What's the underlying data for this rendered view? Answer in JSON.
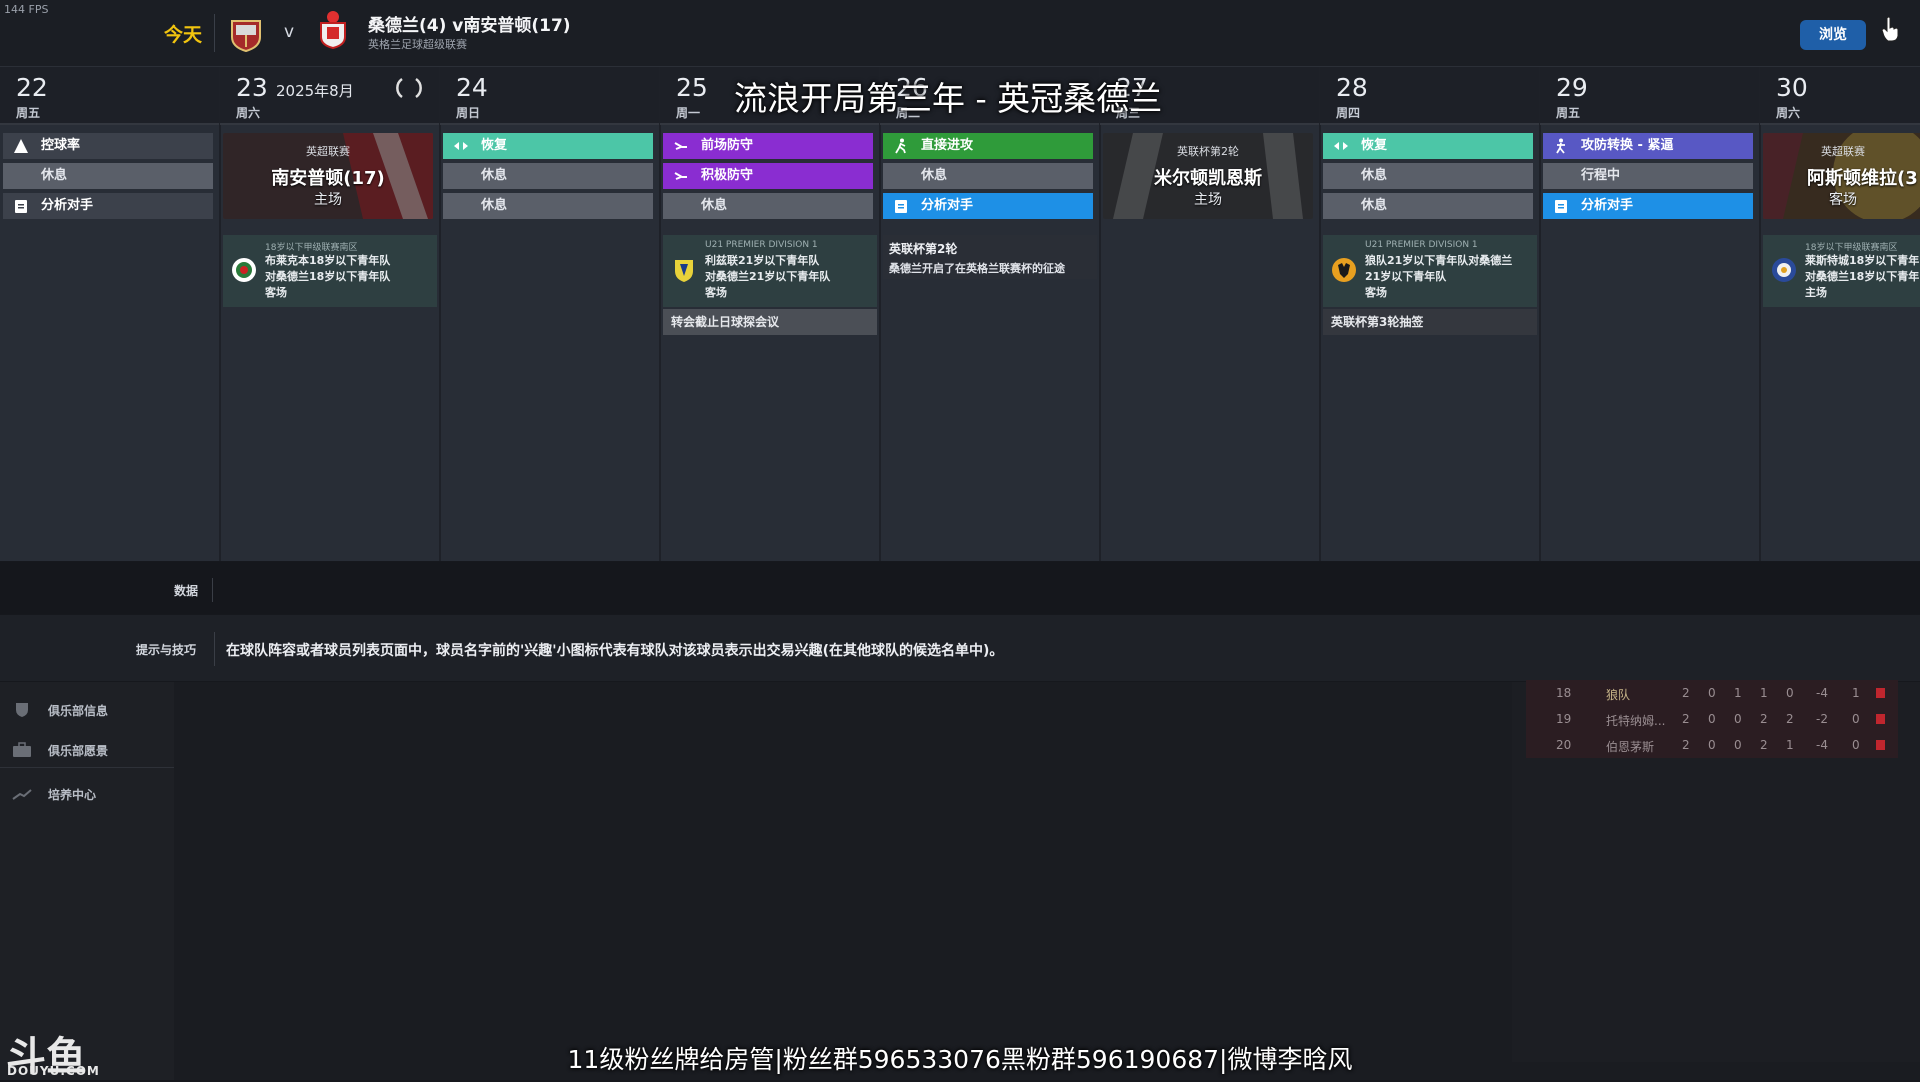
{
  "fps": "144 FPS",
  "header": {
    "today": "今天",
    "vs": "v",
    "match_title": "桑德兰(4) v南安普顿(17)",
    "league": "英格兰足球超级联赛",
    "browse": "浏览"
  },
  "overlay_title": "流浪开局第三年 - 英冠桑德兰",
  "calendar": {
    "month": "2025年8月",
    "days": [
      {
        "num": "22",
        "wk": "周五"
      },
      {
        "num": "23",
        "wk": "周六"
      },
      {
        "num": "24",
        "wk": "周日"
      },
      {
        "num": "25",
        "wk": "周一"
      },
      {
        "num": "26",
        "wk": "周二"
      },
      {
        "num": "27",
        "wk": "周三"
      },
      {
        "num": "28",
        "wk": "周四"
      },
      {
        "num": "29",
        "wk": "周五"
      },
      {
        "num": "30",
        "wk": "周六"
      }
    ],
    "day22": {
      "a1": "控球率",
      "a2": "休息",
      "a3": "分析对手"
    },
    "day23": {
      "comp": "英超联赛",
      "opp": "南安普顿(17)",
      "venue": "主场",
      "yc_league": "18岁以下甲级联赛南区",
      "yc_text": "布莱克本18岁以下青年队\n对桑德兰18岁以下青年队\n客场"
    },
    "day24": {
      "a1": "恢复",
      "a2": "休息",
      "a3": "休息"
    },
    "day25": {
      "a1": "前场防守",
      "a2": "积极防守",
      "a3": "休息",
      "yc_league": "U21 PREMIER DIVISION 1",
      "yc_text": "利兹联21岁以下青年队\n对桑德兰21岁以下青年队\n客场",
      "note": "转会截止日球探会议"
    },
    "day26": {
      "a1": "直接进攻",
      "a2": "休息",
      "a3": "分析对手",
      "cup_title": "英联杯第2轮",
      "cup_text": "桑德兰开启了在英格兰联赛杯的征途"
    },
    "day27": {
      "comp": "英联杯第2轮",
      "opp": "米尔顿凯恩斯",
      "venue": "主场"
    },
    "day28": {
      "a1": "恢复",
      "a2": "休息",
      "a3": "休息",
      "yc_league": "U21 PREMIER DIVISION 1",
      "yc_text": "狼队21岁以下青年队对桑德兰\n21岁以下青年队\n客场",
      "note": "英联杯第3轮抽签"
    },
    "day29": {
      "a1": "攻防转换 - 紧逼",
      "a2": "行程中",
      "a3": "分析对手"
    },
    "day30": {
      "comp": "英超联赛",
      "opp": "阿斯顿维拉(3",
      "venue": "客场",
      "yc_league": "18岁以下甲级联赛南区",
      "yc_text": "莱斯特城18岁以下青年\n对桑德兰18岁以下青年\n主场"
    }
  },
  "data_label": "数据",
  "tips": {
    "label": "提示与技巧",
    "text": "在球队阵容或者球员列表页面中，球员名字前的'兴趣'小图标代表有球队对该球员表示出交易兴趣(在其他球队的候选名单中)。"
  },
  "sidebar": {
    "items": [
      {
        "label": "俱乐部信息"
      },
      {
        "label": "俱乐部愿景"
      },
      {
        "label": "培养中心"
      }
    ]
  },
  "league_table": {
    "rows": [
      {
        "pos": "18",
        "team": "狼队",
        "p": "2",
        "w": "0",
        "d": "1",
        "l": "1",
        "x": "0",
        "gd": "-4",
        "pts": "1"
      },
      {
        "pos": "19",
        "team": "托特纳姆...",
        "p": "2",
        "w": "0",
        "d": "0",
        "l": "2",
        "x": "2",
        "gd": "-2",
        "pts": "0"
      },
      {
        "pos": "20",
        "team": "伯恩茅斯",
        "p": "2",
        "w": "0",
        "d": "0",
        "l": "2",
        "x": "1",
        "gd": "-4",
        "pts": "0"
      }
    ]
  },
  "watermark": {
    "logo": "斗鱼",
    "sub": "DOUYU.COM"
  },
  "bottom_banner": "11级粉丝牌给房管|粉丝群596533076黑粉群596190687|微博李晗风"
}
